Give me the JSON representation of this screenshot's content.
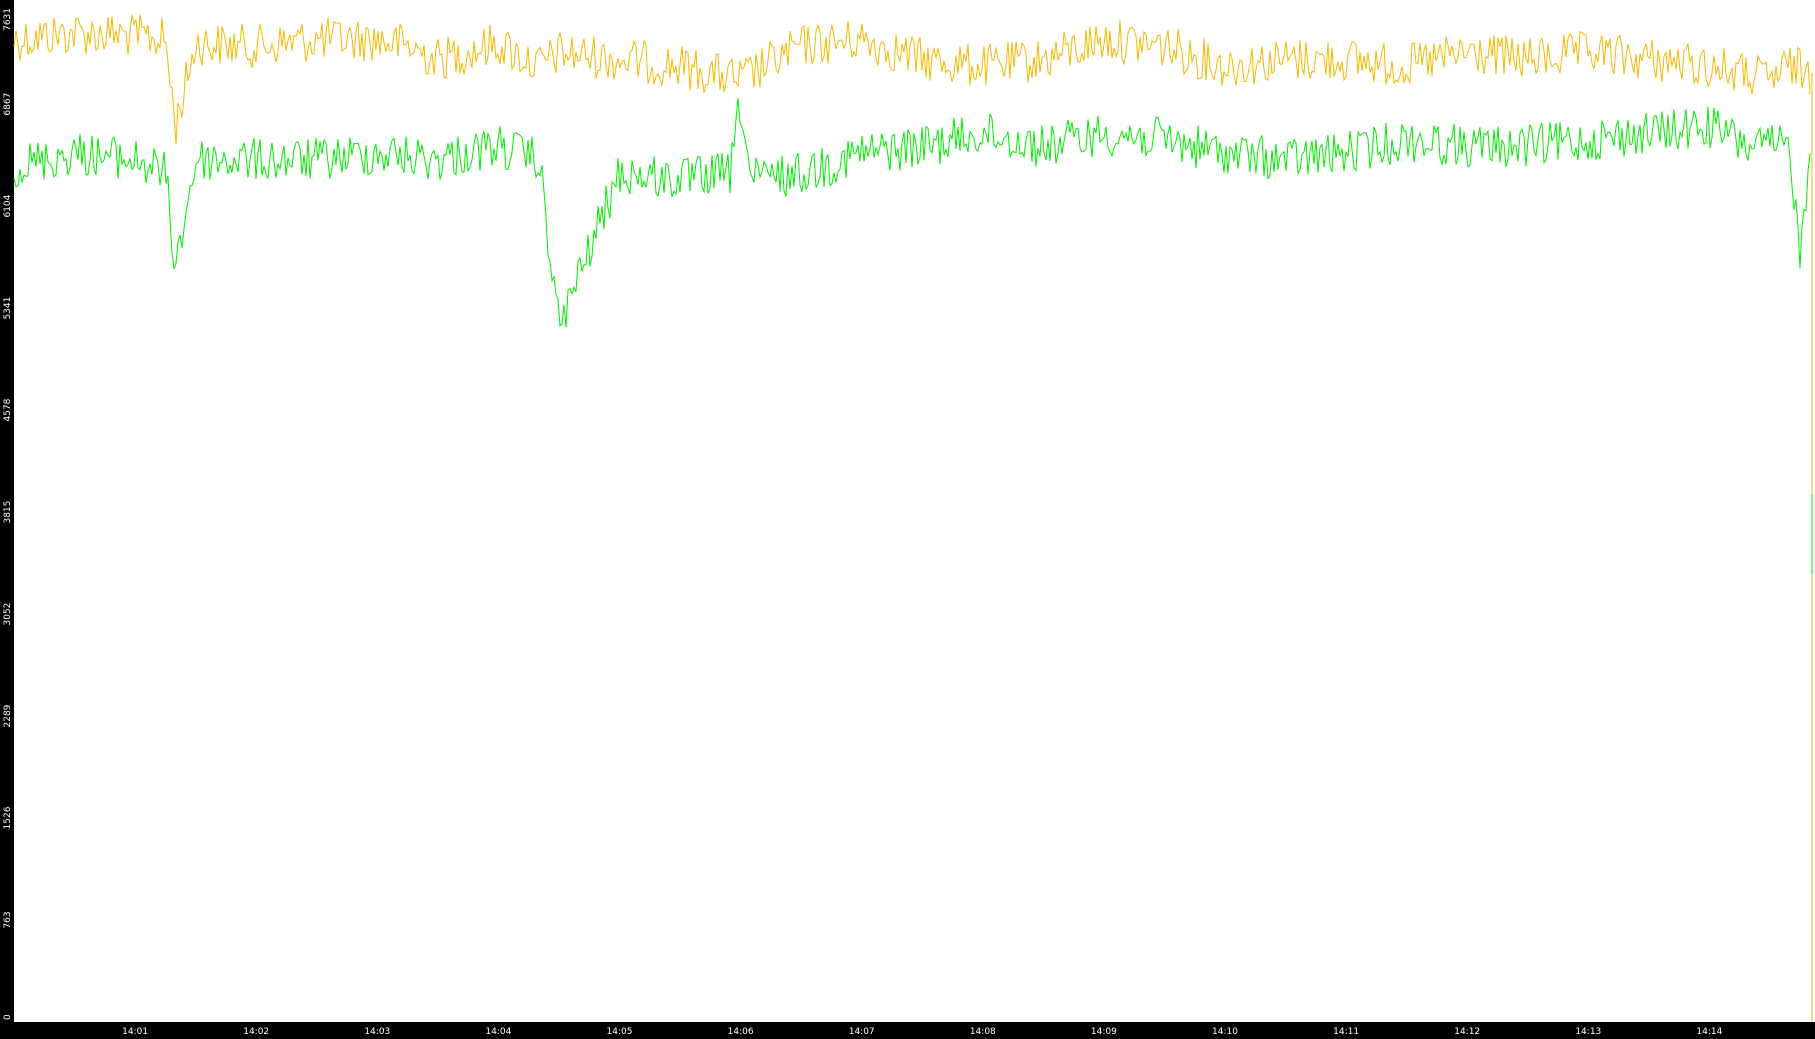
{
  "chart_data": {
    "type": "line",
    "title": "",
    "xlabel": "",
    "ylabel": "",
    "ylim": [
      0,
      7631
    ],
    "x_range": [
      "14:00:00",
      "14:14:54"
    ],
    "x_ticks": [
      "14:01",
      "14:02",
      "14:03",
      "14:04",
      "14:05",
      "14:06",
      "14:07",
      "14:08",
      "14:09",
      "14:10",
      "14:11",
      "14:12",
      "14:13",
      "14:14"
    ],
    "y_ticks": [
      0,
      763,
      1526,
      2289,
      3052,
      3815,
      4578,
      5341,
      6104,
      6867,
      7631
    ],
    "grid": false,
    "legend": "none",
    "colors": {
      "background": "#ffffff",
      "axis_bar": "#000000",
      "axis_text": "#ffffff",
      "orange": "#f5b800",
      "green": "#00ee00"
    },
    "series": [
      {
        "color": "#f5b800",
        "x": [
          "14:00:00",
          "14:00:30",
          "14:01:00",
          "14:01:15",
          "14:01:20",
          "14:01:30",
          "14:02:00",
          "14:02:30",
          "14:03:00",
          "14:03:15",
          "14:03:30",
          "14:04:00",
          "14:04:20",
          "14:04:30",
          "14:05:00",
          "14:05:30",
          "14:06:00",
          "14:06:30",
          "14:07:00",
          "14:07:30",
          "14:08:00",
          "14:08:30",
          "14:09:00",
          "14:09:30",
          "14:10:00",
          "14:10:30",
          "14:11:00",
          "14:11:30",
          "14:12:00",
          "14:12:30",
          "14:13:00",
          "14:13:30",
          "14:14:00",
          "14:14:30",
          "14:14:40",
          "14:14:50"
        ],
        "values": [
          7350,
          7400,
          7380,
          7350,
          6700,
          7320,
          7300,
          7350,
          7350,
          7300,
          7200,
          7320,
          7150,
          7250,
          7200,
          7150,
          7050,
          7300,
          7350,
          7200,
          7150,
          7200,
          7350,
          7300,
          7150,
          7200,
          7200,
          7150,
          7250,
          7200,
          7250,
          7200,
          7150,
          7050,
          7150,
          7100
        ]
      },
      {
        "color": "#00ee00",
        "x": [
          "14:00:00",
          "14:00:30",
          "14:01:00",
          "14:01:15",
          "14:01:20",
          "14:01:30",
          "14:02:00",
          "14:02:30",
          "14:03:00",
          "14:03:30",
          "14:04:00",
          "14:04:20",
          "14:04:30",
          "14:05:00",
          "14:05:30",
          "14:05:55",
          "14:06:00",
          "14:06:05",
          "14:06:30",
          "14:07:00",
          "14:07:30",
          "14:08:00",
          "14:08:30",
          "14:09:00",
          "14:09:30",
          "14:10:00",
          "14:10:30",
          "14:11:00",
          "14:11:30",
          "14:12:00",
          "14:12:30",
          "14:13:00",
          "14:13:30",
          "14:14:00",
          "14:14:20",
          "14:14:40",
          "14:14:45",
          "14:14:50"
        ],
        "values": [
          6400,
          6500,
          6450,
          6350,
          5650,
          6450,
          6450,
          6450,
          6500,
          6450,
          6550,
          6450,
          5200,
          6350,
          6300,
          6350,
          6900,
          6300,
          6350,
          6500,
          6550,
          6650,
          6550,
          6650,
          6600,
          6500,
          6450,
          6500,
          6600,
          6550,
          6550,
          6600,
          6650,
          6700,
          6550,
          6550,
          5700,
          6600
        ]
      }
    ]
  }
}
